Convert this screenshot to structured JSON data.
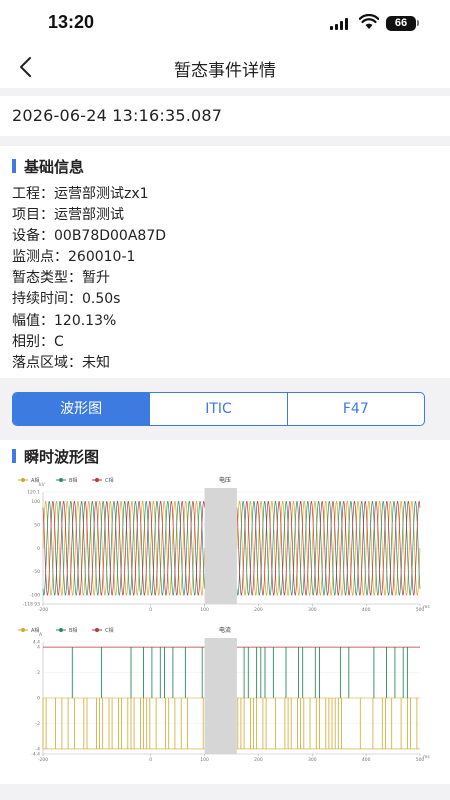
{
  "status_bar": {
    "time": "13:20",
    "battery": "66"
  },
  "nav": {
    "title": "暂态事件详情",
    "back_icon": "chevron-left-icon"
  },
  "event": {
    "timestamp": "2026-06-24 13:16:35.087"
  },
  "basic_info": {
    "title": "基础信息",
    "rows": [
      {
        "label": "工程",
        "value": "运营部测试zx1"
      },
      {
        "label": "项目",
        "value": "运营部测试"
      },
      {
        "label": "设备",
        "value": "00B78D00A87D"
      },
      {
        "label": "监测点",
        "value": "260010-1"
      },
      {
        "label": "暂态类型",
        "value": "暂升"
      },
      {
        "label": "持续时间",
        "value": "0.50s"
      },
      {
        "label": "幅值",
        "value": "120.13%"
      },
      {
        "label": "相别",
        "value": "C"
      },
      {
        "label": "落点区域",
        "value": "未知"
      }
    ]
  },
  "tabs": {
    "items": [
      "波形图",
      "ITIC",
      "F47"
    ],
    "active": 0
  },
  "waveform": {
    "title": "瞬时波形图"
  },
  "colors": {
    "accent": "#3d7be0",
    "phase_a": "#d4a72c",
    "phase_b": "#2e8a63",
    "phase_c": "#b33a3a",
    "gap": "#d6d6d6"
  },
  "chart_data": [
    {
      "type": "line",
      "title": "电压",
      "ylabel": "kV",
      "legend": [
        "A相",
        "B相",
        "C相"
      ],
      "legend_position": "top-left",
      "xlim": [
        -200,
        500
      ],
      "ylim": [
        -118.93,
        120.1
      ],
      "x_ticks": [
        "-200",
        "0",
        "100",
        "200",
        "300",
        "400",
        "500"
      ],
      "y_ticks": [
        "120.1",
        "100",
        "50",
        "0",
        "-50",
        "-100",
        "-118.93"
      ],
      "x_unit": "ms",
      "gap_range": [
        100,
        160
      ],
      "series": [
        {
          "name": "A相",
          "amplitude": 100,
          "phase_deg": 0,
          "frequency_hz": 50
        },
        {
          "name": "B相",
          "amplitude": 100,
          "phase_deg": -120,
          "frequency_hz": 50
        },
        {
          "name": "C相",
          "amplitude": 100,
          "phase_deg": 120,
          "frequency_hz": 50
        }
      ]
    },
    {
      "type": "line",
      "title": "电流",
      "ylabel": "A",
      "legend": [
        "A相",
        "B相",
        "C相"
      ],
      "legend_position": "top-left",
      "xlim": [
        -200,
        500
      ],
      "ylim": [
        -4.4,
        4.4
      ],
      "x_ticks": [
        "-200",
        "0",
        "100",
        "200",
        "300",
        "400",
        "500"
      ],
      "y_ticks": [
        "4.4",
        "4",
        "2",
        "0",
        "-2",
        "-4",
        "-4.4"
      ],
      "x_unit": "ms",
      "gap_range": [
        100,
        160
      ],
      "series": [
        {
          "name": "A相",
          "levels": [
            0,
            -4
          ]
        },
        {
          "name": "B相",
          "levels": [
            0,
            4
          ]
        },
        {
          "name": "C相",
          "levels": [
            4
          ]
        }
      ]
    }
  ]
}
